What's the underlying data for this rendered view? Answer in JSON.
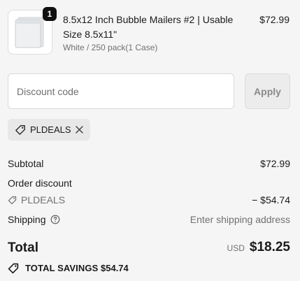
{
  "product": {
    "quantity": "1",
    "title": "8.5x12 Inch Bubble Mailers #2 | Usable Size 8.5x11\"",
    "variant": "White / 250 pack(1 Case)",
    "price": "$72.99",
    "image_icon": "bubble-mailer-image"
  },
  "discount": {
    "placeholder": "Discount code",
    "apply_label": "Apply",
    "applied_code": "PLDEALS",
    "tag_icon": "tag-icon",
    "remove_icon": "close-icon"
  },
  "summary": {
    "subtotal_label": "Subtotal",
    "subtotal_value": "$72.99",
    "order_discount_label": "Order discount",
    "order_discount_code": "PLDEALS",
    "order_discount_value": "− $54.74",
    "shipping_label": "Shipping",
    "shipping_value": "Enter shipping address",
    "total_label": "Total",
    "total_currency": "USD",
    "total_value": "$18.25",
    "savings_label": "TOTAL SAVINGS",
    "savings_value": "$54.74"
  },
  "colors": {
    "background": "#f5f5f5",
    "badge": "#111111",
    "muted_text": "#707070",
    "tag_bg": "#e8e8e8"
  }
}
